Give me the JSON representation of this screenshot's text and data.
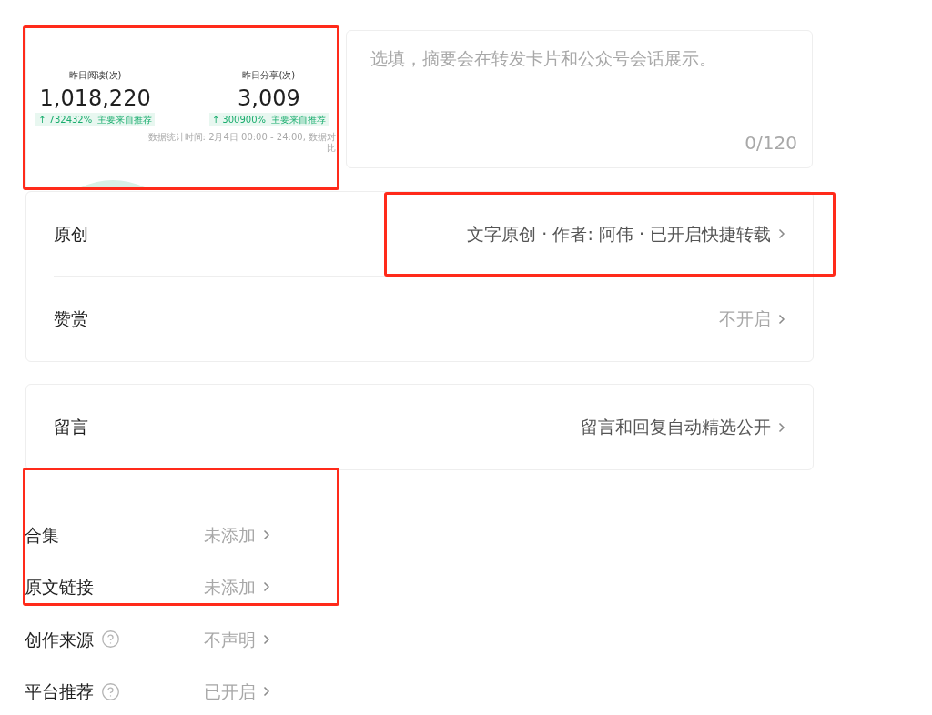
{
  "stats_snapshot": {
    "metrics": [
      {
        "label": "昨日阅读(次)",
        "value": "1,018,220",
        "change": "↑ 732432%",
        "source": "主要来自推荐"
      },
      {
        "label": "昨日分享(次)",
        "value": "3,009",
        "change": "↑ 300900%",
        "source": "主要来自推荐"
      }
    ],
    "footnote": "数据统计时间: 2月4日 00:00 - 24:00, 数据对比"
  },
  "summary": {
    "placeholder": "选填，摘要会在转发卡片和公众号会话展示。",
    "counter": "0/120"
  },
  "card_groups": [
    [
      {
        "label": "原创",
        "value": "文字原创 · 作者: 阿伟 · 已开启快捷转载",
        "active": true
      },
      {
        "label": "赞赏",
        "value": "不开启",
        "active": false
      }
    ],
    [
      {
        "label": "留言",
        "value": "留言和回复自动精选公开",
        "active": true
      }
    ]
  ],
  "settings": [
    {
      "label": "合集",
      "value": "未添加",
      "help": false
    },
    {
      "label": "原文链接",
      "value": "未添加",
      "help": false
    },
    {
      "label": "创作来源",
      "value": "不声明",
      "help": true
    },
    {
      "label": "平台推荐",
      "value": "已开启",
      "help": true
    }
  ]
}
